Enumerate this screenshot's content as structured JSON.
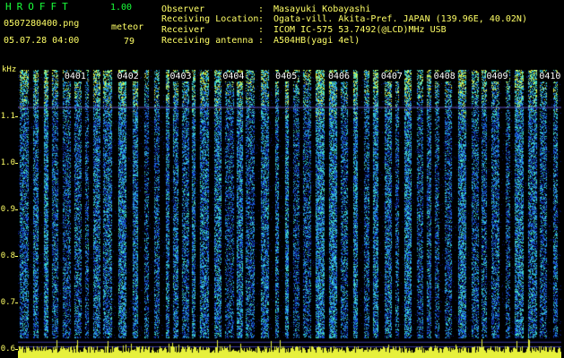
{
  "header": {
    "app_title": "HROFFT",
    "version": "1.00",
    "filename": "0507280400.png",
    "datetime": "05.07.28 04:00",
    "mode_label": "meteor",
    "count": "79"
  },
  "info": [
    {
      "label": "Observer",
      "value": "Masayuki Kobayashi"
    },
    {
      "label": "Receiving Location",
      "value": "Ogata-vill. Akita-Pref. JAPAN (139.96E, 40.02N)"
    },
    {
      "label": "Receiver",
      "value": "ICOM IC-575 53.7492(@LCD)MHz USB"
    },
    {
      "label": "Receiving antenna",
      "value": "A504HB(yagi 4el)"
    }
  ],
  "info_separator": ":",
  "chart_data": {
    "type": "heatmap",
    "title": "",
    "ylabel": "kHz",
    "y_ticks": [
      "1.1",
      "1.0",
      "0.9",
      "0.8",
      "0.7",
      "0.6"
    ],
    "y_tick_values": [
      1.1,
      1.0,
      0.9,
      0.8,
      0.7,
      0.6
    ],
    "ylim": [
      0.58,
      1.2
    ],
    "x_ticks": [
      "0401",
      "0402",
      "0403",
      "0404",
      "0405",
      "0406",
      "0407",
      "0408",
      "0409",
      "0410"
    ],
    "x_tick_minutes": [
      1,
      2,
      3,
      4,
      5,
      6,
      7,
      8,
      9,
      10
    ],
    "xlim_minutes": [
      0,
      10.3
    ],
    "colors": {
      "background": "#000000",
      "low": "#0a1a6e",
      "mid": "#1e6ee6",
      "high": "#2ee6d2",
      "peak": "#e6f03c",
      "axis_text": "#ffff66",
      "title_green": "#19ff3a"
    }
  }
}
